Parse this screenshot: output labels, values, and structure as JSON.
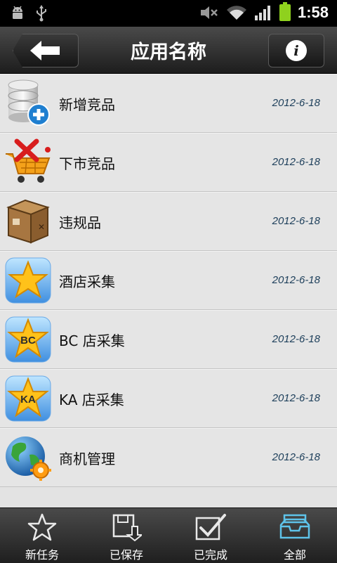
{
  "status_bar": {
    "time": "1:58",
    "icons": [
      "android-debug-icon",
      "usb-icon",
      "mute-icon",
      "wifi-icon",
      "signal-icon",
      "battery-icon"
    ]
  },
  "header": {
    "title": "应用名称",
    "back_icon": "back-arrow-icon",
    "info_icon": "info-icon",
    "info_glyph": "i"
  },
  "list": [
    {
      "icon": "database-add-icon",
      "label": "新增竞品",
      "date": "2012-6-18"
    },
    {
      "icon": "cart-remove-icon",
      "label": "下市竞品",
      "date": "2012-6-18"
    },
    {
      "icon": "box-icon",
      "label": "违规品",
      "date": "2012-6-18"
    },
    {
      "icon": "star-icon",
      "label": "酒店采集",
      "date": "2012-6-18"
    },
    {
      "icon": "star-bc-icon",
      "badge": "BC",
      "label": "BC 店采集",
      "date": "2012-6-18"
    },
    {
      "icon": "star-ka-icon",
      "badge": "KA",
      "label": "KA 店采集",
      "date": "2012-6-18"
    },
    {
      "icon": "globe-gear-icon",
      "label": "商机管理",
      "date": "2012-6-18"
    }
  ],
  "tabs": [
    {
      "icon": "star-outline-icon",
      "label": "新任务",
      "active": false
    },
    {
      "icon": "save-icon",
      "label": "已保存",
      "active": false
    },
    {
      "icon": "check-icon",
      "label": "已完成",
      "active": false
    },
    {
      "icon": "inbox-icon",
      "label": "全部",
      "active": true
    }
  ],
  "colors": {
    "header_bg": "#2b2b2b",
    "list_bg": "#e5e5e5",
    "date_text": "#1c3e5a",
    "active_tab_icon": "#5ec3ea",
    "battery": "#8fd11e"
  }
}
